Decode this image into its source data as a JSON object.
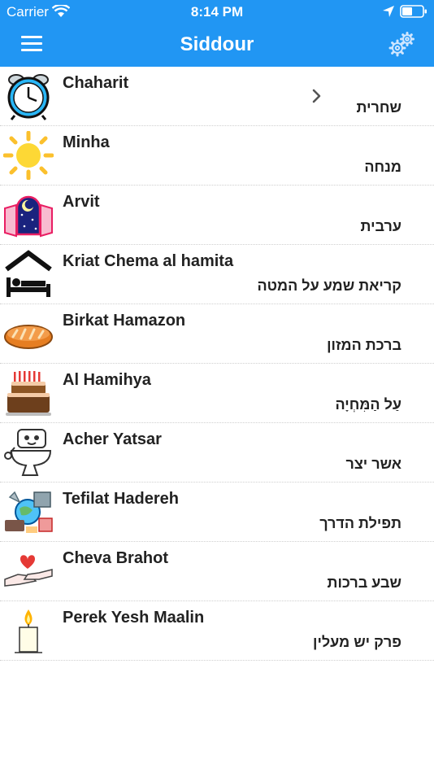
{
  "status_bar": {
    "carrier": "Carrier",
    "time": "8:14 PM"
  },
  "nav": {
    "title": "Siddour",
    "menu_icon": "hamburger-menu-icon",
    "settings_icon": "gears-icon"
  },
  "colors": {
    "brand": "#2196f3",
    "text": "#222222",
    "divider": "#cfcfcf"
  },
  "prayers": [
    {
      "title": "Chaharit",
      "hebrew": "שחרית",
      "icon": "alarm-clock-icon",
      "has_chevron": true
    },
    {
      "title": "Minha",
      "hebrew": "מנחה",
      "icon": "sun-icon"
    },
    {
      "title": "Arvit",
      "hebrew": "ערבית",
      "icon": "night-window-icon"
    },
    {
      "title": "Kriat Chema al hamita",
      "hebrew": "קריאת שמע על המטה",
      "icon": "bed-icon"
    },
    {
      "title": "Birkat Hamazon",
      "hebrew": "ברכת המזון",
      "icon": "bread-icon"
    },
    {
      "title": "Al Hamihya",
      "hebrew": "עַל הַמִּחְיָה",
      "icon": "cake-icon"
    },
    {
      "title": "Acher Yatsar",
      "hebrew": "אשר יצר",
      "icon": "toilet-icon"
    },
    {
      "title": "Tefilat Hadereh",
      "hebrew": "תפילת הדרך",
      "icon": "travel-icon"
    },
    {
      "title": "Cheva Brahot",
      "hebrew": "שבע ברכות",
      "icon": "wedding-hands-icon"
    },
    {
      "title": "Perek Yesh Maalin",
      "hebrew": "פרק יש מעלין",
      "icon": "candle-icon"
    }
  ]
}
